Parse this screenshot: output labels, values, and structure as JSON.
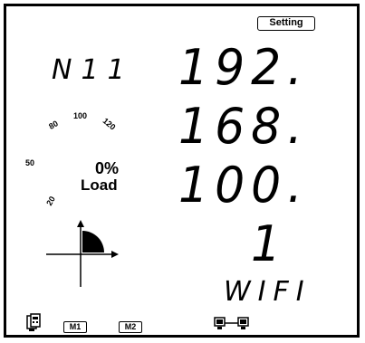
{
  "header": {
    "setting_label": "Setting"
  },
  "node": {
    "id": "N11"
  },
  "ip": {
    "octet1": "192.",
    "octet2": "168.",
    "octet3": "100.",
    "octet4": "1"
  },
  "mode": {
    "label": "WIFI"
  },
  "gauge": {
    "ticks": [
      "50",
      "80",
      "100",
      "120",
      "20"
    ],
    "percent": "0%",
    "load_label": "Load",
    "load_value_percent": 0
  },
  "bottom": {
    "m1_label": "M1",
    "m2_label": "M2"
  },
  "icons": {
    "quadrant": "quadrant-icon",
    "device": "device-icon",
    "network": "network-link-icon"
  }
}
